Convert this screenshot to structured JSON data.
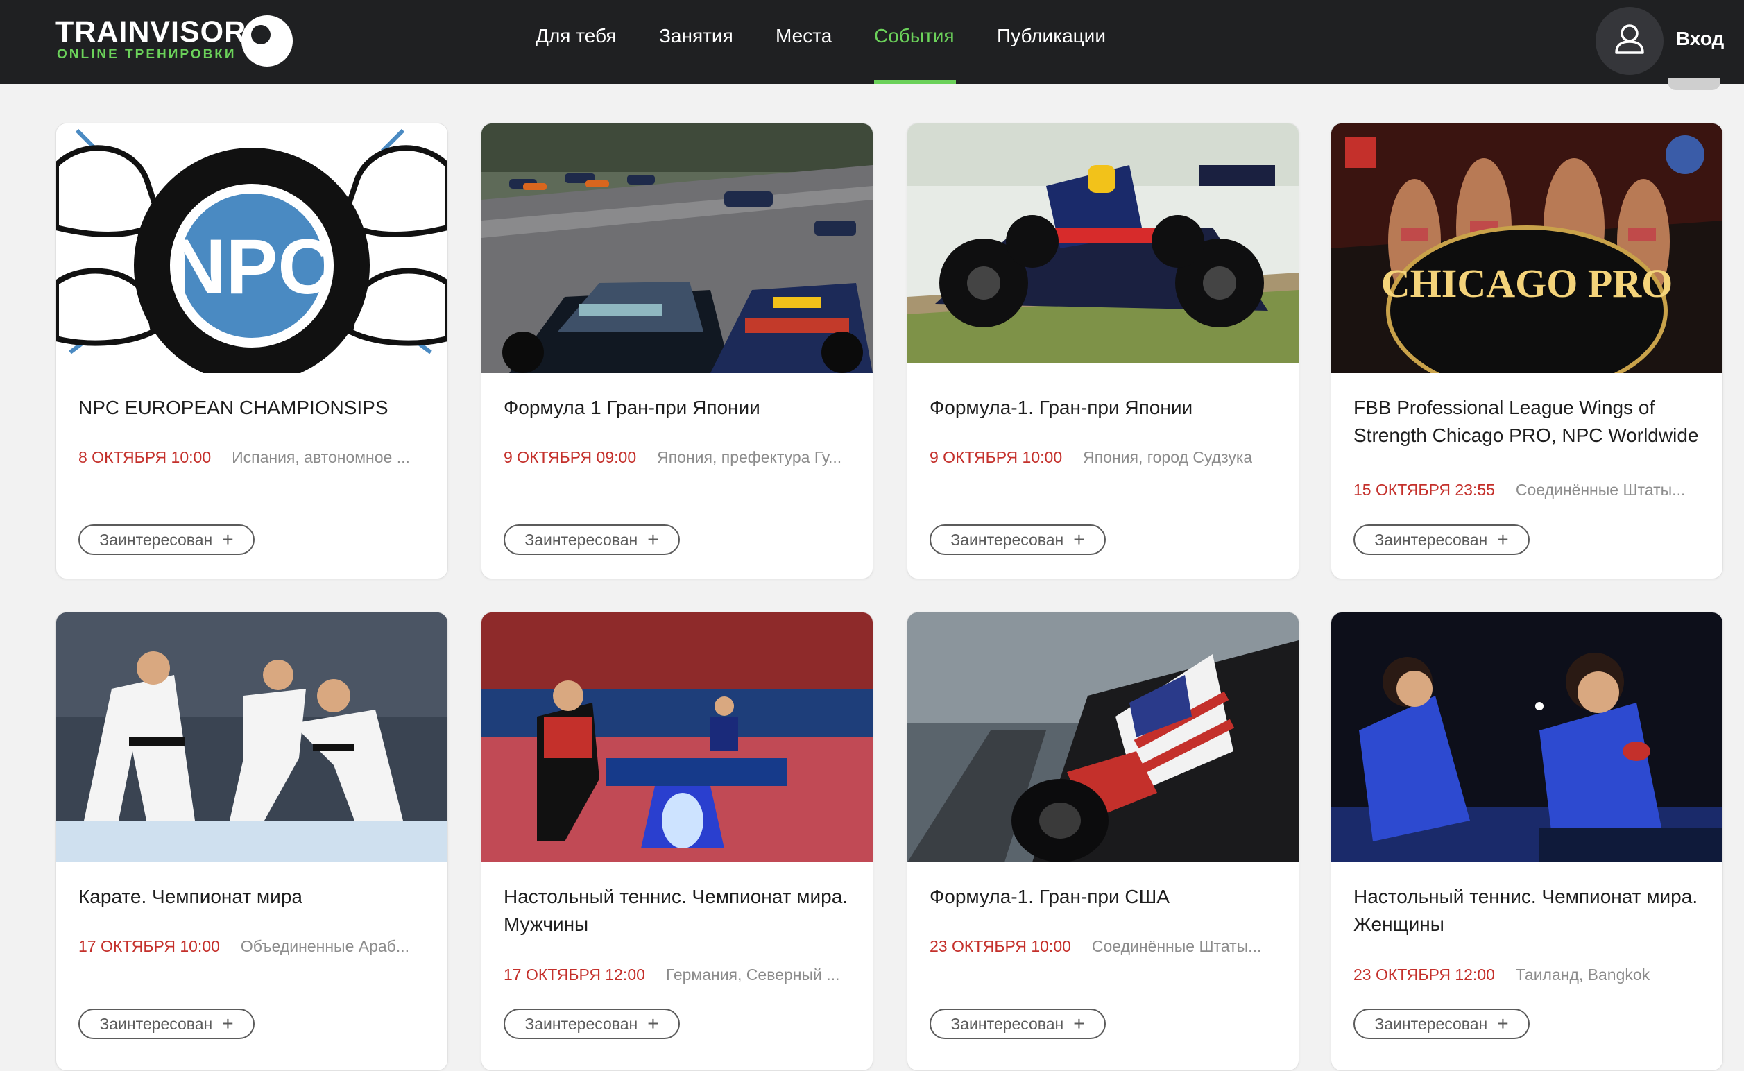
{
  "app": {
    "logo_title": "TRAINVISOR",
    "logo_subtitle": "ONLINE ТРЕНИРОВКИ",
    "login_label": "Вход"
  },
  "nav": {
    "items": [
      "Для тебя",
      "Занятия",
      "Места",
      "События",
      "Публикации"
    ],
    "active": "События"
  },
  "colors": {
    "header_bg": "#1f2022",
    "accent_green": "#6bd15a",
    "date_red": "#c4302b"
  },
  "icons": {
    "user": "user-icon",
    "plus": "plus-icon"
  },
  "cards": [
    {
      "title": "NPC EUROPEAN CHAMPIONSIPS",
      "date": "8 ОКТЯБРЯ 10:00",
      "place": "Испания, автономное ...",
      "button": "Заинтересован",
      "plus": "+"
    },
    {
      "title": "Формула 1 Гран-при Японии",
      "date": "9 ОКТЯБРЯ 09:00",
      "place": "Япония, префектура Гу...",
      "button": "Заинтересован",
      "plus": "+"
    },
    {
      "title": "Формула-1. Гран-при Японии",
      "date": "9 ОКТЯБРЯ 10:00",
      "place": "Япония, город Судзука",
      "button": "Заинтересован",
      "plus": "+"
    },
    {
      "title": "FBB Professional League Wings of Strength Chicago PRO, NPC Worldwide",
      "date": "15 ОКТЯБРЯ 23:55",
      "place": "Соединённые Штаты...",
      "button": "Заинтересован",
      "plus": "+"
    },
    {
      "title": "Карате. Чемпионат мира",
      "date": "17 ОКТЯБРЯ 10:00",
      "place": "Объединенные Араб...",
      "button": "Заинтересован",
      "plus": "+"
    },
    {
      "title": "Настольный теннис. Чемпионат мира. Мужчины",
      "date": "17 ОКТЯБРЯ 12:00",
      "place": "Германия, Северный ...",
      "button": "Заинтересован",
      "plus": "+"
    },
    {
      "title": "Формула-1. Гран-при США",
      "date": "23 ОКТЯБРЯ 10:00",
      "place": "Соединённые Штаты...",
      "button": "Заинтересован",
      "plus": "+"
    },
    {
      "title": "Настольный теннис. Чемпионат мира. Женщины",
      "date": "23 ОКТЯБРЯ 12:00",
      "place": "Таиланд, Bangkok",
      "button": "Заинтересован",
      "plus": "+"
    }
  ],
  "image_text": {
    "npc_logo": "NPC",
    "chicago_pro": "CHICAGO PRO"
  }
}
